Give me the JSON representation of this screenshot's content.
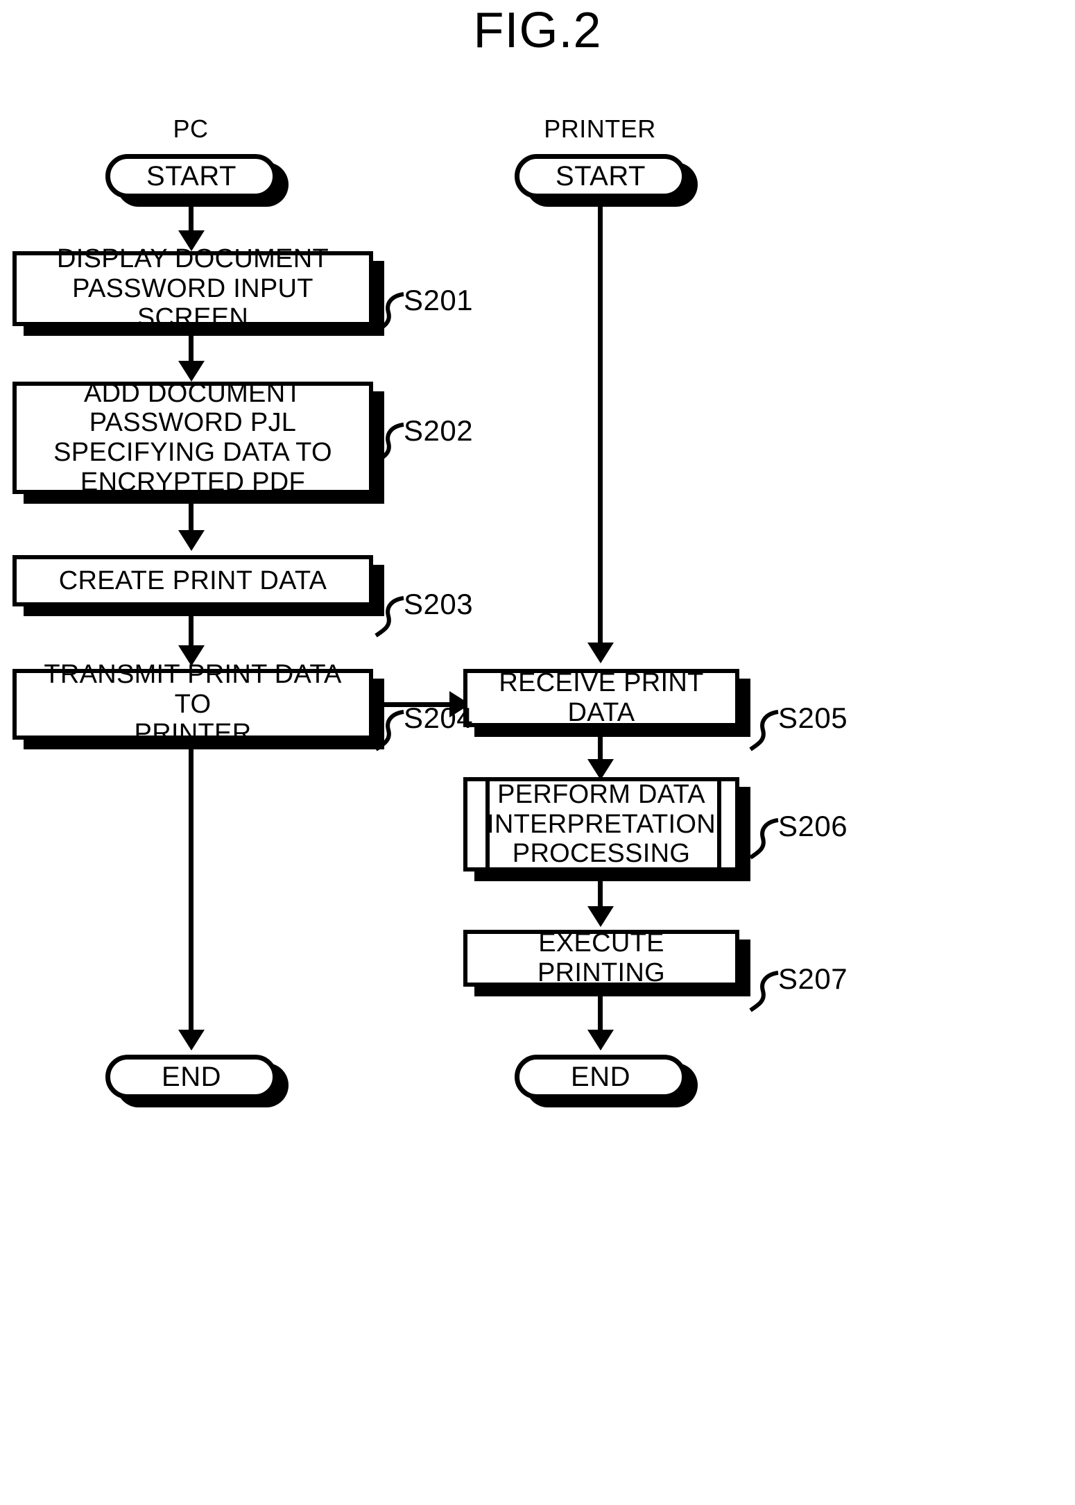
{
  "figure": {
    "title": "FIG.2"
  },
  "lanes": [
    {
      "id": "pc",
      "label": "PC"
    },
    {
      "id": "printer",
      "label": "PRINTER"
    }
  ],
  "pc_flow": {
    "start_label": "START",
    "end_label": "END",
    "steps": [
      {
        "ref": "S201",
        "text": "DISPLAY DOCUMENT\nPASSWORD INPUT SCREEN"
      },
      {
        "ref": "S202",
        "text": "ADD DOCUMENT\nPASSWORD PJL\nSPECIFYING DATA TO\nENCRYPTED PDF"
      },
      {
        "ref": "S203",
        "text": "CREATE PRINT DATA"
      },
      {
        "ref": "S204",
        "text": "TRANSMIT PRINT DATA TO\nPRINTER"
      }
    ]
  },
  "printer_flow": {
    "start_label": "START",
    "end_label": "END",
    "steps": [
      {
        "ref": "S205",
        "text": "RECEIVE PRINT DATA"
      },
      {
        "ref": "S206",
        "text": "PERFORM DATA\nINTERPRETATION\nPROCESSING"
      },
      {
        "ref": "S207",
        "text": "EXECUTE PRINTING"
      }
    ]
  },
  "colors": {
    "ink": "#000000",
    "paper": "#ffffff"
  }
}
